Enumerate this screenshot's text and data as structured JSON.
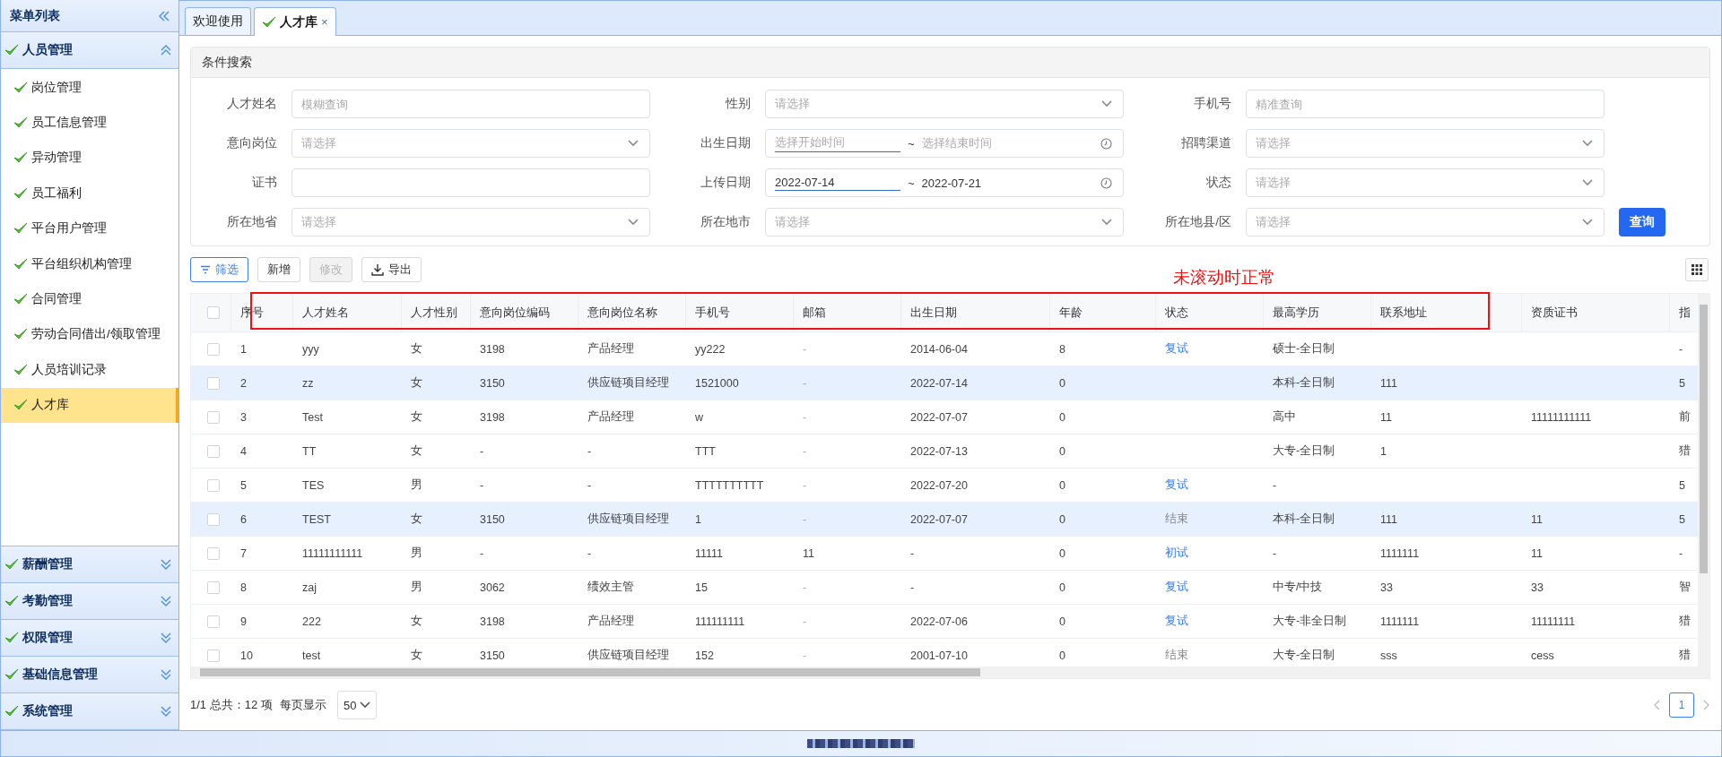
{
  "sidebar": {
    "title": "菜单列表",
    "groups": [
      {
        "label": "人员管理",
        "expanded": true,
        "items": [
          {
            "label": "岗位管理",
            "selected": false
          },
          {
            "label": "员工信息管理",
            "selected": false
          },
          {
            "label": "异动管理",
            "selected": false
          },
          {
            "label": "员工福利",
            "selected": false
          },
          {
            "label": "平台用户管理",
            "selected": false
          },
          {
            "label": "平台组织机构管理",
            "selected": false
          },
          {
            "label": "合同管理",
            "selected": false
          },
          {
            "label": "劳动合同借出/领取管理",
            "selected": false
          },
          {
            "label": "人员培训记录",
            "selected": false
          },
          {
            "label": "人才库",
            "selected": true
          }
        ]
      },
      {
        "label": "薪酬管理",
        "expanded": false
      },
      {
        "label": "考勤管理",
        "expanded": false
      },
      {
        "label": "权限管理",
        "expanded": false
      },
      {
        "label": "基础信息管理",
        "expanded": false
      },
      {
        "label": "系统管理",
        "expanded": false
      }
    ]
  },
  "tabs": [
    {
      "label": "欢迎使用",
      "selected": false
    },
    {
      "label": "人才库",
      "selected": true,
      "close": "×"
    }
  ],
  "search": {
    "title": "条件搜索",
    "fields": [
      {
        "label": "人才姓名",
        "kind": "text",
        "placeholder": "模糊查询"
      },
      {
        "label": "性别",
        "kind": "select",
        "placeholder": "请选择"
      },
      {
        "label": "手机号",
        "kind": "text",
        "placeholder": "精准查询"
      },
      {
        "label": "意向岗位",
        "kind": "select",
        "placeholder": "请选择"
      },
      {
        "label": "出生日期",
        "kind": "daterange",
        "start": {
          "placeholder": "选择开始时间"
        },
        "separator": "~",
        "end": {
          "placeholder": "选择结束时间"
        }
      },
      {
        "label": "招聘渠道",
        "kind": "select",
        "placeholder": "请选择"
      },
      {
        "label": "证书",
        "kind": "text"
      },
      {
        "label": "上传日期",
        "kind": "daterange",
        "start": {
          "value": "2022-07-14"
        },
        "separator": "~",
        "end": {
          "value": "2022-07-21"
        }
      },
      {
        "label": "状态",
        "kind": "select",
        "placeholder": "请选择"
      },
      {
        "label": "所在地省",
        "kind": "select",
        "placeholder": "请选择"
      },
      {
        "label": "所在地市",
        "kind": "select",
        "placeholder": "请选择"
      },
      {
        "label": "所在地县/区",
        "kind": "select",
        "placeholder": "请选择"
      }
    ],
    "submit": "查询"
  },
  "toolbar": {
    "buttons": [
      {
        "label": "筛选",
        "kind": "filter",
        "primary": true,
        "disabled": false
      },
      {
        "label": "新增",
        "kind": "plain",
        "primary": false,
        "disabled": false
      },
      {
        "label": "修改",
        "kind": "plain",
        "primary": false,
        "disabled": true
      },
      {
        "label": "导出",
        "kind": "download",
        "primary": false,
        "disabled": false
      }
    ]
  },
  "table": {
    "header_checked": false,
    "columns": [
      "序号",
      "人才姓名",
      "人才性别",
      "意向岗位编码",
      "意向岗位名称",
      "手机号",
      "邮箱",
      "出生日期",
      "年龄",
      "状态",
      "最高学历",
      "联系地址",
      "资质证书",
      "指"
    ],
    "rows": [
      {
        "checked": false,
        "highlighted": false,
        "cells": [
          "1",
          "yyy",
          "女",
          "3198",
          "产品经理",
          "yy222",
          "-",
          "2014-06-04",
          "8",
          {
            "text": "复试",
            "color": "#3b7ff0"
          },
          "硕士-全日制",
          null,
          null,
          "-"
        ]
      },
      {
        "checked": false,
        "highlighted": true,
        "cells": [
          "2",
          "zz",
          "女",
          "3150",
          "供应链项目经理",
          "1521000",
          "-",
          "2022-07-14",
          "0",
          null,
          "本科-全日制",
          "111",
          null,
          "5"
        ]
      },
      {
        "checked": false,
        "highlighted": false,
        "cells": [
          "3",
          "Test",
          "女",
          "3198",
          "产品经理",
          "w",
          "-",
          "2022-07-07",
          "0",
          null,
          "高中",
          "11",
          "11111111111",
          "前"
        ]
      },
      {
        "checked": false,
        "highlighted": false,
        "cells": [
          "4",
          "TT",
          "女",
          "-",
          "-",
          "TTT",
          "-",
          "2022-07-13",
          "0",
          null,
          "大专-全日制",
          "1",
          null,
          "猎"
        ]
      },
      {
        "checked": false,
        "highlighted": false,
        "cells": [
          "5",
          "TES",
          "男",
          "-",
          "-",
          "TTTTTTTTTT",
          "-",
          "2022-07-20",
          "0",
          {
            "text": "复试",
            "color": "#3b7ff0"
          },
          "-",
          null,
          null,
          "5"
        ]
      },
      {
        "checked": false,
        "highlighted": true,
        "cells": [
          "6",
          "TEST",
          "女",
          "3150",
          "供应链项目经理",
          "1",
          "-",
          "2022-07-07",
          "0",
          {
            "text": "结束",
            "color": "#888888"
          },
          "本科-全日制",
          "111",
          "11",
          "5"
        ]
      },
      {
        "checked": false,
        "highlighted": false,
        "cells": [
          "7",
          "11111111111",
          "男",
          "-",
          "-",
          "11111",
          "11",
          "-",
          "0",
          {
            "text": "初试",
            "color": "#3b7ff0"
          },
          "-",
          "1111111",
          "11",
          "-"
        ]
      },
      {
        "checked": false,
        "highlighted": false,
        "cells": [
          "8",
          "zaj",
          "男",
          "3062",
          "绩效主管",
          "15",
          "-",
          "-",
          "0",
          {
            "text": "复试",
            "color": "#3b7ff0"
          },
          "中专/中技",
          "33",
          "33",
          "智"
        ]
      },
      {
        "checked": false,
        "highlighted": false,
        "cells": [
          "9",
          "222",
          "女",
          "3198",
          "产品经理",
          "111111111",
          "-",
          "2022-07-06",
          "0",
          {
            "text": "复试",
            "color": "#3b7ff0"
          },
          "大专-非全日制",
          "1111111",
          "11111111",
          "猎"
        ]
      },
      {
        "checked": false,
        "highlighted": false,
        "cells": [
          "10",
          "test",
          "女",
          "3150",
          "供应链项目经理",
          "152",
          "-",
          "2001-07-10",
          "0",
          {
            "text": "结束",
            "color": "#888888"
          },
          "大专-全日制",
          "sss",
          "cess",
          "猎"
        ]
      }
    ]
  },
  "annotation": {
    "text": "未滚动时正常"
  },
  "pager": {
    "summary": "1/1 总共：12 项",
    "page_size_label": "每页显示",
    "page_size": "50",
    "pages": [
      {
        "label": "1",
        "selected": true
      }
    ]
  }
}
